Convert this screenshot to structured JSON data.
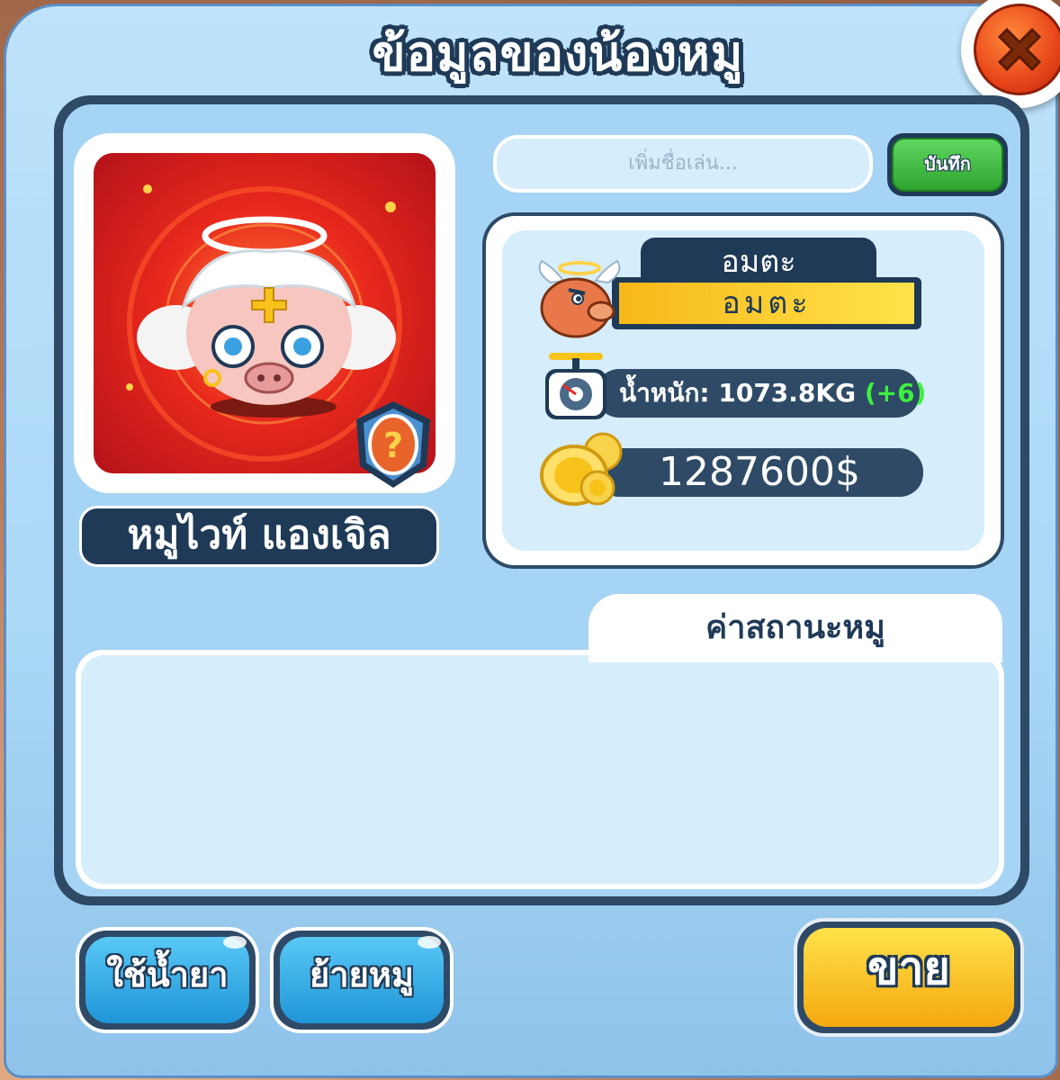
{
  "dialog": {
    "title": "ข้อมูลของน้องหมู"
  },
  "pig": {
    "name": "หมูไวท์ แองเจิล",
    "nickname_placeholder": "เพิ่มชื่อเล่น...",
    "save_label": "บันทึก",
    "status_title": "อมตะ",
    "status_value": "อมตะ",
    "weight_label": "น้ำหนัก: 1073.8KG",
    "weight_delta": "(+6)",
    "money": "1287600$"
  },
  "stats": {
    "tab_label": "ค่าสถานะหมู"
  },
  "buttons": {
    "use_potion": "ใช้น้ำยา",
    "move_pig": "ย้ายหมู",
    "sell": "ขาย"
  },
  "colors": {
    "navy": "#1f3a57",
    "panel_blue": "#a6d4f4",
    "green_button": "#2ea52e",
    "yellow_button": "#f5a80f",
    "delta_green": "#3ef03e",
    "close_red": "#e8451a"
  },
  "icons": {
    "close": "close-x-icon",
    "pig_avatar": "angel-pig-icon",
    "rarity": "mystery-egg-badge-icon",
    "status": "winged-pig-icon",
    "weight": "scale-icon",
    "money": "gold-coins-icon"
  }
}
